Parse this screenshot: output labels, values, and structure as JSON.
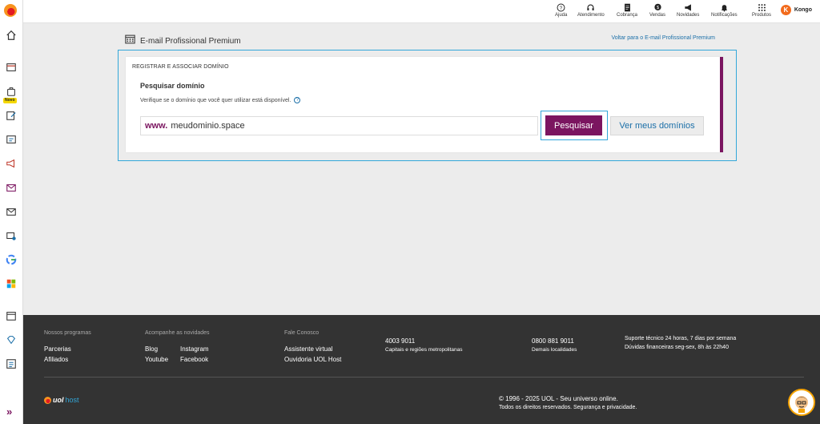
{
  "topbar": {
    "items": [
      {
        "label": "Ajuda",
        "icon": "help-icon"
      },
      {
        "label": "Atendimento",
        "icon": "headset-icon"
      },
      {
        "label": "Cobrança",
        "icon": "document-icon"
      },
      {
        "label": "Vendas",
        "icon": "dollar-bubble-icon"
      },
      {
        "label": "Novidades",
        "icon": "megaphone-icon"
      },
      {
        "label": "Notificações",
        "icon": "bell-icon"
      },
      {
        "label": "Produtos",
        "icon": "grid-icon"
      }
    ],
    "user": {
      "initial": "K",
      "name": "Kongo"
    }
  },
  "sidebar": {
    "novo_badge": "Novo",
    "icons": [
      "home-icon",
      "store-icon",
      "shop-bag-icon",
      "edit-icon",
      "dashboard-icon",
      "megaphone-icon",
      "email-marketing-icon",
      "mail-icon",
      "mail-settings-icon",
      "google-icon",
      "microsoft-icon",
      "building-icon",
      "diamond-icon",
      "list-icon"
    ],
    "expand_label": "»"
  },
  "header": {
    "title": "E-mail Profissional Premium",
    "back_link": "Voltar para o E-mail Profissional Premium"
  },
  "panel": {
    "section_label": "REGISTRAR E ASSOCIAR DOMÍNIO",
    "search_title": "Pesquisar domínio",
    "search_help": "Verifique se o domínio que você quer utilizar está disponível.",
    "help_icon": "?",
    "www_prefix": "www.",
    "domain_value": "meudominio.space",
    "search_button": "Pesquisar",
    "my_domains_button": "Ver meus domínios"
  },
  "footer": {
    "col1": {
      "heading": "Nossos programas",
      "links": [
        "Parcerias",
        "Afiliados"
      ]
    },
    "col2": {
      "heading": "Acompanhe as novidades",
      "links": [
        "Blog",
        "Youtube",
        "Instagram",
        "Facebook"
      ]
    },
    "col3": {
      "heading": "Fale Conosco",
      "links": [
        "Assistente virtual",
        "Ouvidoria UOL Host"
      ]
    },
    "phone1": {
      "number": "4003 9011",
      "desc": "Capitais e regiões metropolitanas"
    },
    "phone2": {
      "number": "0800 881 9011",
      "desc": "Demais localidades"
    },
    "support": {
      "line1": "Suporte técnico 24 horas, 7 dias por semana",
      "line2": "Dúvidas financeiras seg-sex, 8h às 22h40"
    },
    "logo": {
      "brand": "uol",
      "product": "host"
    },
    "copyright": "© 1996 - 2025 UOL - Seu universo online.",
    "rights": "Todos os direitos reservados. Segurança e privacidade."
  },
  "colors": {
    "brand": "#7b1560",
    "accent": "#33a7d9",
    "link": "#1b6fa8",
    "footer_bg": "#333333"
  }
}
